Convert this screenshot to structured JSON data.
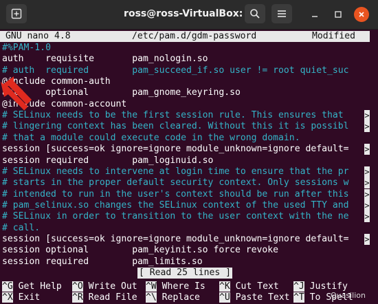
{
  "window": {
    "title": "ross@ross-VirtualBox: ~",
    "icons": [
      "new-tab-icon",
      "search-icon",
      "menu-icon",
      "minimize-icon",
      "maximize-icon",
      "close-icon"
    ]
  },
  "nano": {
    "version": "GNU nano 4.8",
    "file": "/etc/pam.d/gdm-password",
    "state": "Modified",
    "lines": [
      {
        "t": "#%PAM-1.0",
        "comment": true
      },
      {
        "t": "auth    requisite       pam_nologin.so",
        "comment": false
      },
      {
        "t": "# auth  required        pam_succeed_if.so user != root quiet_suc",
        "comment": true
      },
      {
        "t": "@include common-auth",
        "comment": false
      },
      {
        "t": "auth    optional        pam_gnome_keyring.so",
        "comment": false
      },
      {
        "t": "@include common-account",
        "comment": false
      },
      {
        "t": "# SELinux needs to be the first session rule. This ensures that ",
        "comment": true,
        "more": true
      },
      {
        "t": "# lingering context has been cleared. Without this it is possibl",
        "comment": true,
        "more": true
      },
      {
        "t": "# that a module could execute code in the wrong domain.",
        "comment": true
      },
      {
        "t": "session [success=ok ignore=ignore module_unknown=ignore default=",
        "comment": false,
        "more": true
      },
      {
        "t": "session required        pam_loginuid.so",
        "comment": false
      },
      {
        "t": "# SELinux needs to intervene at login time to ensure that the pr",
        "comment": true,
        "more": true
      },
      {
        "t": "# starts in the proper default security context. Only sessions w",
        "comment": true,
        "more": true
      },
      {
        "t": "# intended to run in the user's context should be run after this",
        "comment": true,
        "more": true
      },
      {
        "t": "# pam_selinux.so changes the SELinux context of the used TTY and",
        "comment": true,
        "more": true
      },
      {
        "t": "# SELinux in order to transition to the user context with the ne",
        "comment": true,
        "more": true
      },
      {
        "t": "# call.",
        "comment": true
      },
      {
        "t": "session [success=ok ignore=ignore module_unknown=ignore default=",
        "comment": false,
        "more": true
      },
      {
        "t": "session optional        pam_keyinit.so force revoke",
        "comment": false
      },
      {
        "t": "session required        pam_limits.so",
        "comment": false
      }
    ],
    "more_marker": ">",
    "status": "[ Read 25 lines ]",
    "shortcuts_row1": [
      {
        "key": "^G",
        "label": "Get Help"
      },
      {
        "key": "^O",
        "label": "Write Out"
      },
      {
        "key": "^W",
        "label": "Where Is"
      },
      {
        "key": "^K",
        "label": "Cut Text"
      },
      {
        "key": "^J",
        "label": "Justify"
      }
    ],
    "shortcuts_row2": [
      {
        "key": "^X",
        "label": "Exit"
      },
      {
        "key": "^R",
        "label": "Read File"
      },
      {
        "key": "^\\",
        "label": "Replace"
      },
      {
        "key": "^U",
        "label": "Paste Text"
      },
      {
        "key": "^T",
        "label": "To Spell"
      }
    ]
  },
  "watermark": "Quasilion",
  "accent": "#e95420",
  "terminal_bg": "#300a24",
  "comment_color": "#34b4c8"
}
